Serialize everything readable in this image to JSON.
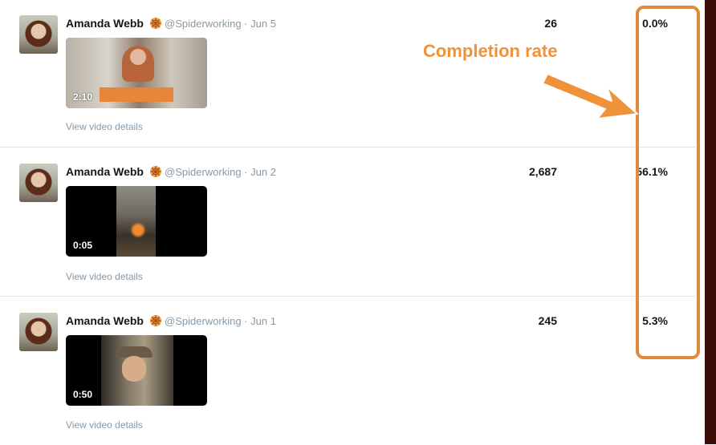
{
  "rows": [
    {
      "author": "Amanda Webb",
      "handle_date": "@Spiderworking · Jun 5",
      "duration": "2:10",
      "details_link": "View video details",
      "views": "26",
      "completion_rate": "0.0%"
    },
    {
      "author": "Amanda Webb",
      "handle_date": "@Spiderworking · Jun 2",
      "duration": "0:05",
      "details_link": "View video details",
      "views": "2,687",
      "completion_rate": "56.1%"
    },
    {
      "author": "Amanda Webb",
      "handle_date": "@Spiderworking · Jun 1",
      "duration": "0:50",
      "details_link": "View video details",
      "views": "245",
      "completion_rate": "5.3%"
    }
  ],
  "annotation": {
    "label": "Completion rate",
    "color": "#f0923a",
    "box_color": "#e08a3c"
  },
  "icons": {
    "author_emoji": "spider-web-emoji-icon"
  }
}
